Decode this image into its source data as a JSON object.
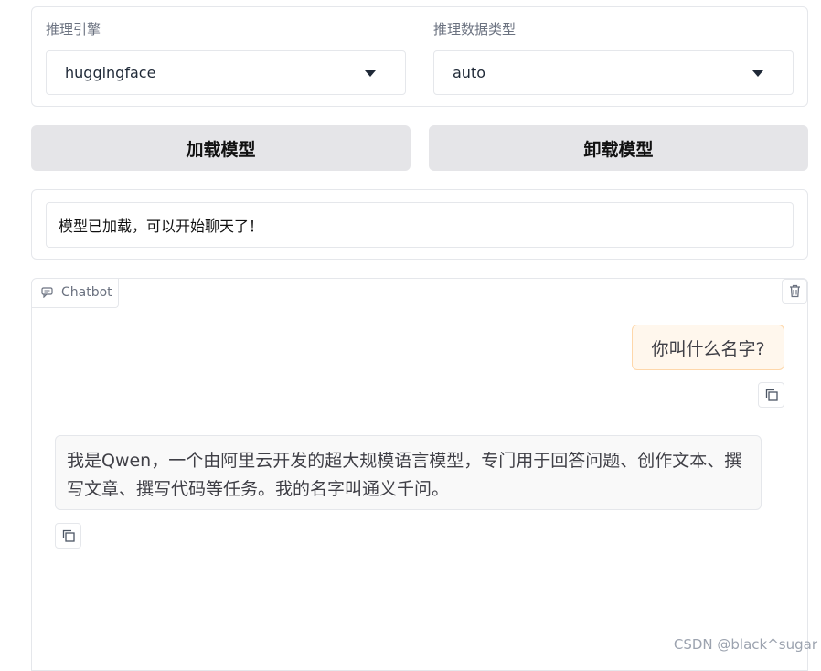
{
  "engine": {
    "label": "推理引擎",
    "value": "huggingface"
  },
  "dtype": {
    "label": "推理数据类型",
    "value": "auto"
  },
  "buttons": {
    "load": "加载模型",
    "unload": "卸载模型"
  },
  "status": {
    "text": "模型已加载，可以开始聊天了！"
  },
  "chatbot": {
    "label": "Chatbot",
    "messages": [
      {
        "role": "user",
        "text": "你叫什么名字?"
      },
      {
        "role": "assistant",
        "text": "我是Qwen，一个由阿里云开发的超大规模语言模型，专门用于回答问题、创作文本、撰写文章、撰写代码等任务。我的名字叫通义千问。"
      }
    ]
  },
  "watermark": "CSDN @black^sugar",
  "colors": {
    "button_bg": "#e5e5e8",
    "user_bubble_bg": "#fff7ed",
    "user_bubble_border": "#fed7aa",
    "bot_bubble_bg": "#f9f9f9"
  }
}
